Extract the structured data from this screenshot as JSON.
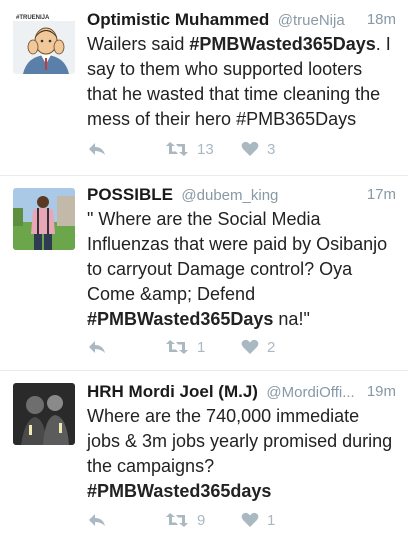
{
  "tweets": [
    {
      "name": "Optimistic Muhammed",
      "handle": "@trueNija",
      "time": "18m",
      "text_plain_before": "Wailers said ",
      "hashtag": "#PMBWasted365Days",
      "text_plain_after": ". I say to them who supported looters that he wasted that time cleaning the mess of their hero #PMB365Days",
      "retweets": "13",
      "likes": "3",
      "avatar_label": "#TRUENIJA"
    },
    {
      "name": "POSSIBLE",
      "handle": "@dubem_king",
      "time": "17m",
      "text_plain_before": "\" Where are the Social Media Influenzas that were paid by Osibanjo to carryout Damage control? Oya Come &amp; Defend\n",
      "hashtag": "#PMBWasted365Days",
      "text_plain_after": " na!\"",
      "retweets": "1",
      "likes": "2"
    },
    {
      "name": "HRH Mordi Joel (M.J)",
      "handle": "@MordiOffi...",
      "time": "19m",
      "text_plain_before": "Where are the 740,000 immediate jobs & 3m jobs yearly promised during the campaigns?\n",
      "hashtag": "#PMBWasted365days",
      "text_plain_after": "",
      "retweets": "9",
      "likes": "1"
    }
  ],
  "colors": {
    "icon": "#aab8c2",
    "handle": "#8899a6",
    "divider": "#e6ecf0"
  },
  "icons": {
    "reply": "reply-icon",
    "retweet": "retweet-icon",
    "like": "heart-icon"
  }
}
